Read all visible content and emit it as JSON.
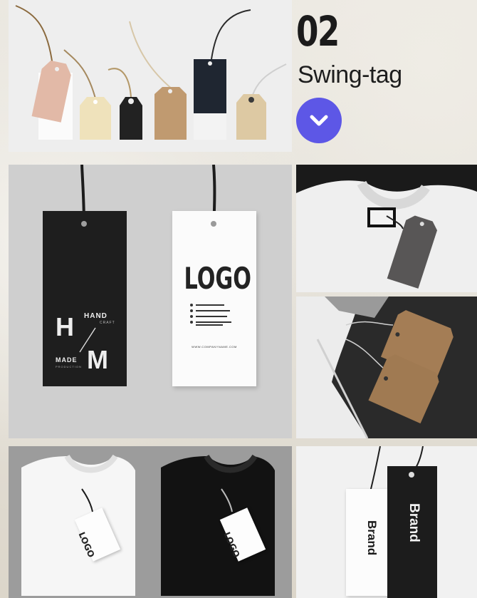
{
  "header": {
    "number": "02",
    "title": "Swing-tag"
  },
  "actions": {
    "expand_icon": "chevron-down-icon"
  },
  "mockups": {
    "handmade_tag": {
      "hand": "HAND",
      "craft": "CRAFT",
      "h": "H",
      "made": "MADE",
      "m": "M",
      "production": "PRODUCTION"
    },
    "logo_tag": {
      "logo": "LOGO",
      "website": "WWW.COMPANYNAME.COM"
    },
    "tshirt_white_tag": "LOGO",
    "tshirt_black_tag": "LOGO",
    "brand_tag_white": "Brand",
    "brand_tag_black": "Brand"
  },
  "colors": {
    "accent": "#5d57e6",
    "heading": "#1b1b1b",
    "background": "#e7e4dc"
  }
}
